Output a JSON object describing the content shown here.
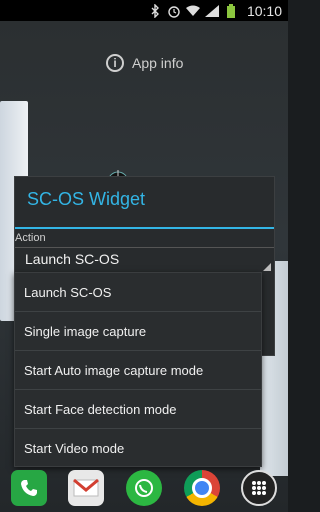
{
  "status_bar": {
    "time": "10:10"
  },
  "home": {
    "app_info_label": "App info"
  },
  "dialog": {
    "title": "SC-OS Widget",
    "section_label": "Action",
    "selected_value": "Launch SC-OS"
  },
  "dropdown": {
    "options": [
      "Launch SC-OS",
      "Single image capture",
      "Start Auto image capture mode",
      "Start Face detection mode",
      "Start Video mode"
    ]
  },
  "colors": {
    "accent": "#33b5e5",
    "battery": "#8cc63f"
  },
  "icons": [
    "bluetooth-icon",
    "alarm-icon",
    "wifi-icon",
    "signal-icon",
    "battery-icon",
    "info-icon",
    "phone-icon",
    "gmail-icon",
    "whatsapp-icon",
    "chrome-icon",
    "apps-icon"
  ]
}
